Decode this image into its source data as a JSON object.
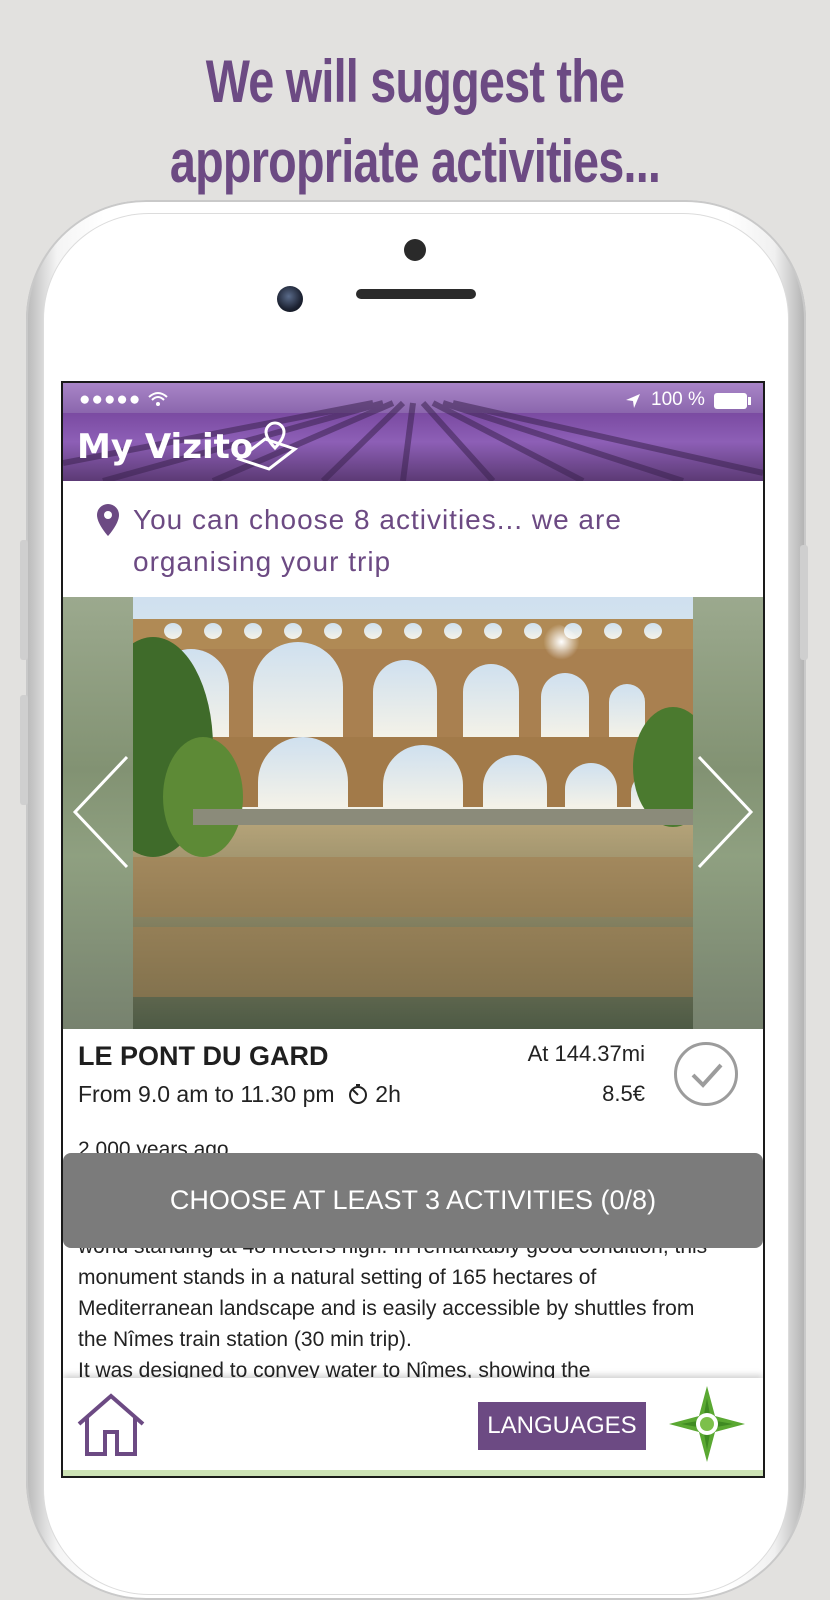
{
  "headline": {
    "line1": "We will suggest the",
    "line2": "appropriate activities..."
  },
  "status_bar": {
    "battery_text": "100 %"
  },
  "app": {
    "logo_text": "My Vizito"
  },
  "subtitle": {
    "text": "You can choose 8 activities... we are organising your trip"
  },
  "activity": {
    "title": "LE PONT DU GARD",
    "hours": "From 9.0 am to 11.30 pm",
    "duration": "2h",
    "distance": "At 144.37mi",
    "price": "8.5€",
    "description_top": "2,000 years ago...",
    "description_lines": [
      "world standing at 48 meters high. In remarkably good condition, this",
      "monument stands in a natural setting of 165 hectares of",
      "Mediterranean landscape and is easily accessible by shuttles from",
      "the Nîmes train station (30 min trip).",
      "It was designed to convey water to Nîmes, showing the"
    ]
  },
  "cta": {
    "label": "CHOOSE AT LEAST 3 ACTIVITIES (0/8)"
  },
  "bottom_bar": {
    "languages_label": "LANGUAGES"
  },
  "colors": {
    "brand_purple": "#6c4a83",
    "cta_grey": "#7b7b7b",
    "compass_green": "#5aa832"
  }
}
